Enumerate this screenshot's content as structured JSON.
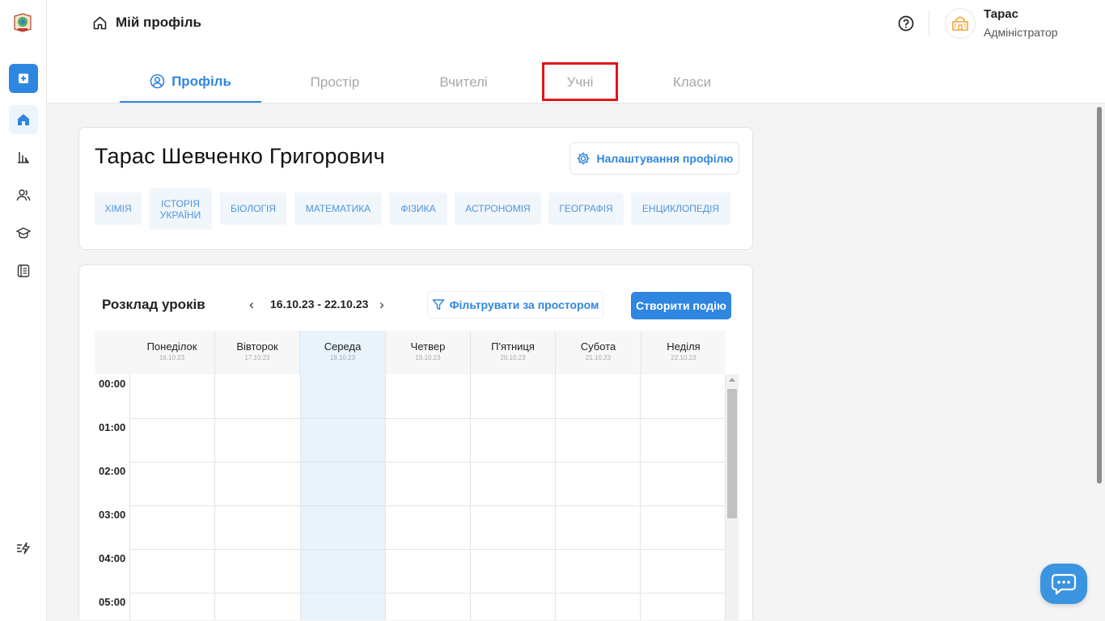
{
  "sidebar": {
    "logo_icon": "school-logo-icon",
    "items": [
      {
        "name": "add-icon"
      },
      {
        "name": "home-icon",
        "active": true
      },
      {
        "name": "analytics-icon"
      },
      {
        "name": "users-icon"
      },
      {
        "name": "graduation-cap-icon"
      },
      {
        "name": "journal-icon"
      },
      {
        "name": "quick-actions-icon"
      }
    ]
  },
  "header": {
    "breadcrumb": "Мій профіль",
    "user": {
      "name": "Тарас",
      "role": "Адміністратор"
    }
  },
  "tabs": [
    {
      "label": "Профіль",
      "active": true
    },
    {
      "label": "Простір",
      "active": false
    },
    {
      "label": "Вчителі",
      "active": false
    },
    {
      "label": "Учні",
      "active": false,
      "highlighted": true
    },
    {
      "label": "Класи",
      "active": false
    }
  ],
  "profile": {
    "name": "Тарас Шевченко Григорович",
    "settings_label": "Налаштування профілю",
    "subjects": [
      "ХІМІЯ",
      "ІСТОРІЯ УКРАЇНИ",
      "БІОЛОГІЯ",
      "МАТЕМАТИКА",
      "ФІЗИКА",
      "АСТРОНОМІЯ",
      "ГЕОГРАФІЯ",
      "ЕНЦИКЛОПЕДІЯ"
    ]
  },
  "schedule": {
    "title": "Розклад уроків",
    "prev": "‹",
    "next": "›",
    "week_range": "16.10.23 - 22.10.23",
    "filter_label": "Фільтрувати за простором",
    "create_label": "Створити подію",
    "days": [
      {
        "name": "Понеділок",
        "date": "16.10.23"
      },
      {
        "name": "Вівторок",
        "date": "17.10.23"
      },
      {
        "name": "Середа",
        "date": "18.10.23",
        "today": true
      },
      {
        "name": "Четвер",
        "date": "19.10.23"
      },
      {
        "name": "П'ятниця",
        "date": "20.10.23"
      },
      {
        "name": "Субота",
        "date": "21.10.23"
      },
      {
        "name": "Неділя",
        "date": "22.10.23"
      }
    ],
    "times": [
      "00:00",
      "01:00",
      "02:00",
      "03:00",
      "04:00",
      "05:00"
    ]
  },
  "colors": {
    "accent": "#2f86e0",
    "highlight": "#e2141b",
    "today": "#e8f3fc",
    "chip_bg": "#f1f6fb",
    "chip_text": "#4d95dc"
  },
  "chat_icon": "chat-bubble-icon"
}
